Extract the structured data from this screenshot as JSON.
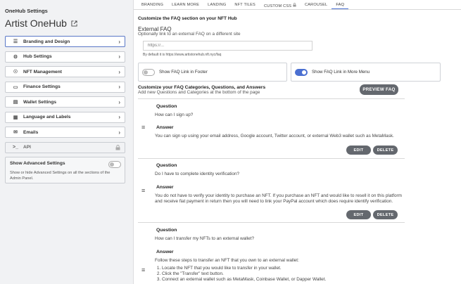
{
  "sidebar": {
    "heading": "OneHub Settings",
    "app_name": "Artist OneHub",
    "items": [
      {
        "label": "Branding and Design",
        "icon": "☰"
      },
      {
        "label": "Hub Settings",
        "icon": "⚙"
      },
      {
        "label": "NFT Management",
        "icon": "☉"
      },
      {
        "label": "Finance Settings",
        "icon": "▭"
      },
      {
        "label": "Wallet Settings",
        "icon": "▤"
      },
      {
        "label": "Language and Labels",
        "icon": "▦"
      },
      {
        "label": "Emails",
        "icon": "✉"
      },
      {
        "label": "API",
        "icon": ">_"
      }
    ],
    "advanced": {
      "title": "Show Advanced Settings",
      "desc": "Show or hide Advanced Settings on all the sections of the Admin Panel."
    }
  },
  "tabs": [
    "BRANDING",
    "LEARN MORE",
    "LANDING",
    "NFT TILES",
    "CUSTOM CSS",
    "CAROUSEL",
    "FAQ"
  ],
  "active_tab": "FAQ",
  "main": {
    "heading": "Customize the FAQ section on your NFT Hub",
    "external_title": "External FAQ",
    "external_sub": "Optionally link to an external FAQ on a different site",
    "external_placeholder": "https://...",
    "external_help": "By default it is https://www.artistonehub.nft.nyc/faq",
    "toggle_footer": "Show FAQ Link in Footer",
    "toggle_more": "Show FAQ Link in More Menu",
    "custom_title": "Customize your FAQ Categories, Questions, and Answers",
    "custom_sub": "Add new Questions and Categories at the bottom of the page",
    "preview_label": "PREVIEW FAQ",
    "question_label": "Question",
    "answer_label": "Answer",
    "edit_label": "EDIT",
    "delete_label": "DELETE",
    "faqs": [
      {
        "question": "How can I sign up?",
        "answer": "You can sign up using your email address, Google account, Twitter account, or external Web3 wallet such as MetaMask."
      },
      {
        "question": "Do I have to complete identity verification?",
        "answer": "You do not have to verify your identity to purchase an NFT. If you purchase an NFT and would like to resell it on this platform and receive fiat payment in return then you will need to link your PayPal account which does require identify verification."
      },
      {
        "question": "How can I transfer my NFTs to an external wallet?",
        "answer": "Follow these steps to transfer an NFT that you own to an external wallet:",
        "steps": [
          "Locate the NFT that you would like to transfer in your wallet.",
          "Click the \"Transfer\" text button.",
          "Connect an external wallet such as MetaMask, Coinbase Wallet, or Dapper Wallet."
        ]
      }
    ]
  }
}
